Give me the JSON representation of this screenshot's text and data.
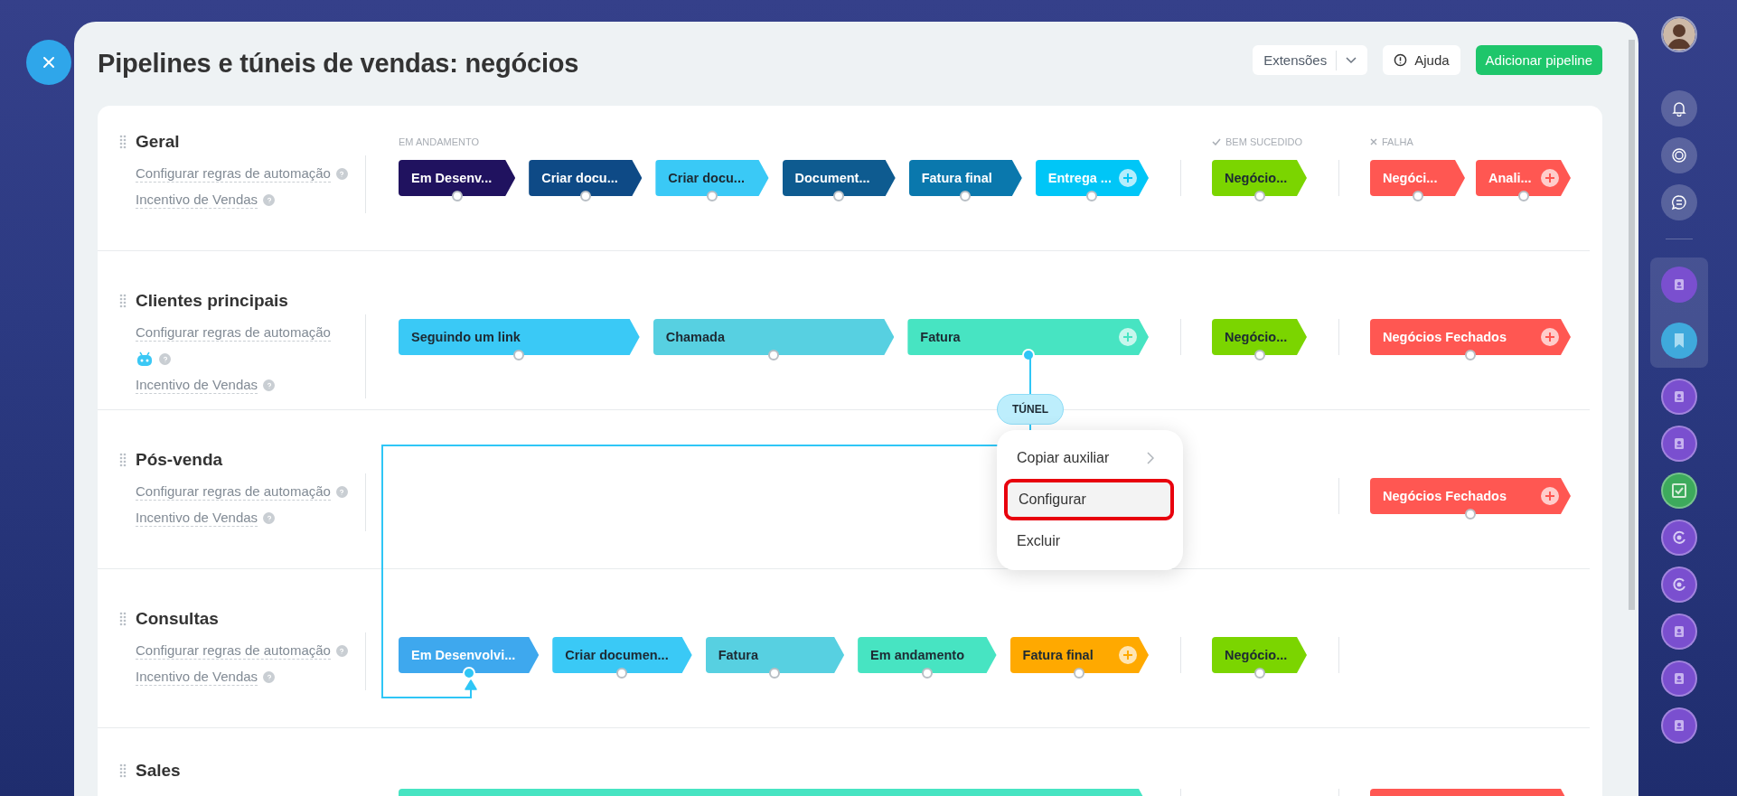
{
  "title": "Pipelines e túneis de vendas: negócios",
  "header_buttons": {
    "extensions": "Extensões",
    "help": "Ajuda",
    "add_pipeline": "Adicionar pipeline"
  },
  "column_headers": {
    "in_progress": "EM ANDAMENTO",
    "success": "BEM SUCEDIDO",
    "failure": "FALHA"
  },
  "pipelines": [
    {
      "name": "Geral",
      "automation_link": "Configurar regras de automação",
      "robot": false,
      "incentive_link": "Incentivo de Vendas",
      "in_progress": [
        {
          "label": "Em Desenv...",
          "color": "#20125f",
          "tunnel": false,
          "add": false
        },
        {
          "label": "Criar docu...",
          "color": "#0e4a86",
          "tunnel": false,
          "add": false
        },
        {
          "label": "Criar docu...",
          "color": "#3ac9f6",
          "tunnel": false,
          "add": false
        },
        {
          "label": "Document...",
          "color": "#0e5b90",
          "tunnel": false,
          "add": false
        },
        {
          "label": "Fatura final",
          "color": "#0a78ad",
          "tunnel": false,
          "add": false
        },
        {
          "label": "Entrega ...",
          "color": "#00c6f7",
          "tunnel": false,
          "add": true
        }
      ],
      "success": [
        {
          "label": "Negócio...",
          "color": "#7bd500",
          "tunnel": false,
          "add": false
        }
      ],
      "failure": [
        {
          "label": "Negóci...",
          "color": "#ff5752",
          "tunnel": false,
          "add": false
        },
        {
          "label": "Anali...",
          "color": "#ff5752",
          "tunnel": false,
          "add": true
        }
      ]
    },
    {
      "name": "Clientes principais",
      "automation_link": "Configurar regras de automação",
      "robot": true,
      "incentive_link": "Incentivo de Vendas",
      "in_progress": [
        {
          "label": "Seguindo um link",
          "color": "#3ac9f6",
          "tunnel": false,
          "add": false
        },
        {
          "label": "Chamada",
          "color": "#57d0e1",
          "tunnel": false,
          "add": false
        },
        {
          "label": "Fatura",
          "color": "#47e4c2",
          "tunnel": true,
          "add": true
        }
      ],
      "success": [
        {
          "label": "Negócio...",
          "color": "#7bd500",
          "tunnel": false,
          "add": false
        }
      ],
      "failure": [
        {
          "label": "Negócios Fechados",
          "color": "#ff5752",
          "tunnel": false,
          "add": true
        }
      ]
    },
    {
      "name": "Pós-venda",
      "automation_link": "Configurar regras de automação",
      "robot": false,
      "incentive_link": "Incentivo de Vendas",
      "failure": [
        {
          "label": "Negócios Fechados",
          "color": "#ff5752",
          "tunnel": false,
          "add": true
        }
      ]
    },
    {
      "name": "Consultas",
      "automation_link": "Configurar regras de automação",
      "robot": false,
      "incentive_link": "Incentivo de Vendas",
      "in_progress": [
        {
          "label": "Em Desenvolvi...",
          "color": "#3ea8ee",
          "tunnel": true,
          "add": false
        },
        {
          "label": "Criar documen...",
          "color": "#3ac9f6",
          "tunnel": false,
          "add": false
        },
        {
          "label": "Fatura",
          "color": "#57d0e1",
          "tunnel": false,
          "add": false
        },
        {
          "label": "Em andamento",
          "color": "#47e4c2",
          "tunnel": false,
          "add": false
        },
        {
          "label": "Fatura final",
          "color": "#ffa900",
          "tunnel": false,
          "add": true
        }
      ],
      "success": [
        {
          "label": "Negócio...",
          "color": "#7bd500",
          "tunnel": false,
          "add": false
        }
      ]
    },
    {
      "name": "Sales",
      "in_progress": [
        {
          "color": "#47e4c2"
        }
      ],
      "failure": [
        {
          "color": "#ff5752"
        }
      ]
    }
  ],
  "tunnel": {
    "label": "TÚNEL"
  },
  "context_menu": {
    "items": [
      {
        "label": "Copiar auxiliar",
        "submenu": true,
        "highlighted": false
      },
      {
        "label": "Configurar",
        "submenu": false,
        "highlighted": true
      },
      {
        "label": "Excluir",
        "submenu": false,
        "highlighted": false
      }
    ]
  }
}
